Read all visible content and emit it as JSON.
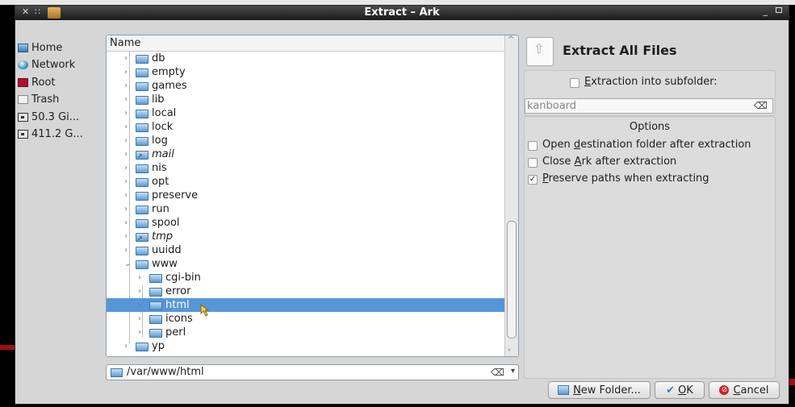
{
  "window": {
    "title": "Extract – Ark"
  },
  "places": [
    {
      "label": "Home",
      "icon": "home-folder-icon"
    },
    {
      "label": "Network",
      "icon": "network-icon"
    },
    {
      "label": "Root",
      "icon": "root-folder-icon"
    },
    {
      "label": "Trash",
      "icon": "trash-icon"
    },
    {
      "label": "50.3 Gi...",
      "icon": "disk-icon"
    },
    {
      "label": "411.2 G...",
      "icon": "disk-icon"
    }
  ],
  "tree": {
    "header": "Name",
    "items": [
      {
        "label": "db",
        "italic": false
      },
      {
        "label": "empty",
        "italic": false
      },
      {
        "label": "games",
        "italic": false
      },
      {
        "label": "lib",
        "italic": false
      },
      {
        "label": "local",
        "italic": false
      },
      {
        "label": "lock",
        "italic": false
      },
      {
        "label": "log",
        "italic": false
      },
      {
        "label": "mail",
        "italic": true
      },
      {
        "label": "nis",
        "italic": false
      },
      {
        "label": "opt",
        "italic": false
      },
      {
        "label": "preserve",
        "italic": false
      },
      {
        "label": "run",
        "italic": false
      },
      {
        "label": "spool",
        "italic": false
      },
      {
        "label": "tmp",
        "italic": true
      },
      {
        "label": "uuidd",
        "italic": false
      },
      {
        "label": "www",
        "italic": false
      },
      {
        "label": "cgi-bin",
        "italic": false
      },
      {
        "label": "error",
        "italic": false
      },
      {
        "label": "html",
        "italic": false
      },
      {
        "label": "icons",
        "italic": false
      },
      {
        "label": "perl",
        "italic": false
      },
      {
        "label": "yp",
        "italic": false
      }
    ],
    "selected": "html"
  },
  "path": {
    "value": "/var/www/html"
  },
  "right": {
    "title": "Extract All Files",
    "subfolder_label": "Extraction into subfolder:",
    "subfolder_value": "kanboard",
    "options_title": "Options",
    "options": [
      {
        "label": "Open destination folder after extraction",
        "checked": false
      },
      {
        "label": "Close Ark after extraction",
        "checked": false
      },
      {
        "label": "Preserve paths when extracting",
        "checked": true
      }
    ]
  },
  "buttons": {
    "new_folder": "New Folder...",
    "ok": "OK",
    "cancel": "Cancel"
  },
  "colors": {
    "selection": "#5696d8",
    "title_bar": "#1a1a1a"
  }
}
